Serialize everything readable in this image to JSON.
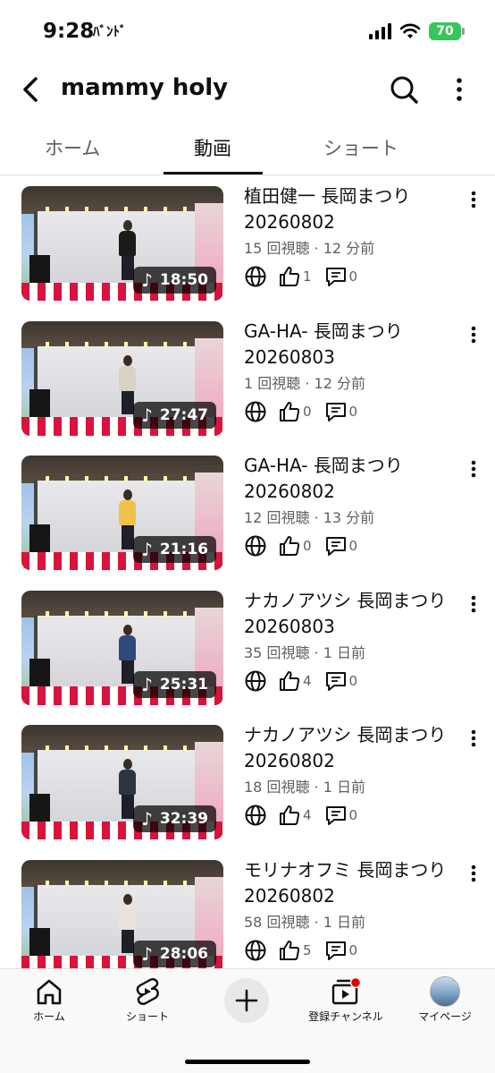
{
  "status_bar": {
    "time": "9:28",
    "extra_glyph": "ﾊﾞﾝﾄﾞ",
    "battery": "70",
    "battery_color": "#34c759"
  },
  "header": {
    "back_icon": "chevron-left-icon",
    "title": "mammy holy",
    "search_icon": "search-icon",
    "more_icon": "more-vertical-icon"
  },
  "tabs": [
    {
      "label": "ホーム",
      "active": false
    },
    {
      "label": "動画",
      "active": true
    },
    {
      "label": "ショート",
      "active": false
    }
  ],
  "videos": [
    {
      "title": "植田健一 長岡まつり 20260802",
      "meta": "15 回視聴 · 12 分前",
      "duration": "18:50",
      "likes": "1",
      "comments": "0",
      "shirt": "#1a1a1a"
    },
    {
      "title": "GA-HA- 長岡まつり 20260803",
      "meta": "1 回視聴 · 12 分前",
      "duration": "27:47",
      "likes": "0",
      "comments": "0",
      "shirt": "#d9d2c4"
    },
    {
      "title": "GA-HA- 長岡まつり 20260802",
      "meta": "12 回視聴 · 13 分前",
      "duration": "21:16",
      "likes": "0",
      "comments": "0",
      "shirt": "#f0c24a"
    },
    {
      "title": "ナカノアツシ 長岡まつり 20260803",
      "meta": "35 回視聴 · 1 日前",
      "duration": "25:31",
      "likes": "4",
      "comments": "0",
      "shirt": "#2c4a7a"
    },
    {
      "title": "ナカノアツシ 長岡まつり 20260802",
      "meta": "18 回視聴 · 1 日前",
      "duration": "32:39",
      "likes": "4",
      "comments": "0",
      "shirt": "#2d3540"
    },
    {
      "title": "モリナオフミ 長岡まつり 20260802",
      "meta": "58 回視聴 · 1 日前",
      "duration": "28:06",
      "likes": "5",
      "comments": "0",
      "shirt": "#e8e4da"
    }
  ],
  "bottom_nav": {
    "home": "ホーム",
    "shorts": "ショート",
    "subscriptions": "登録チャンネル",
    "mypage": "マイページ",
    "notification_color": "#e00000"
  }
}
